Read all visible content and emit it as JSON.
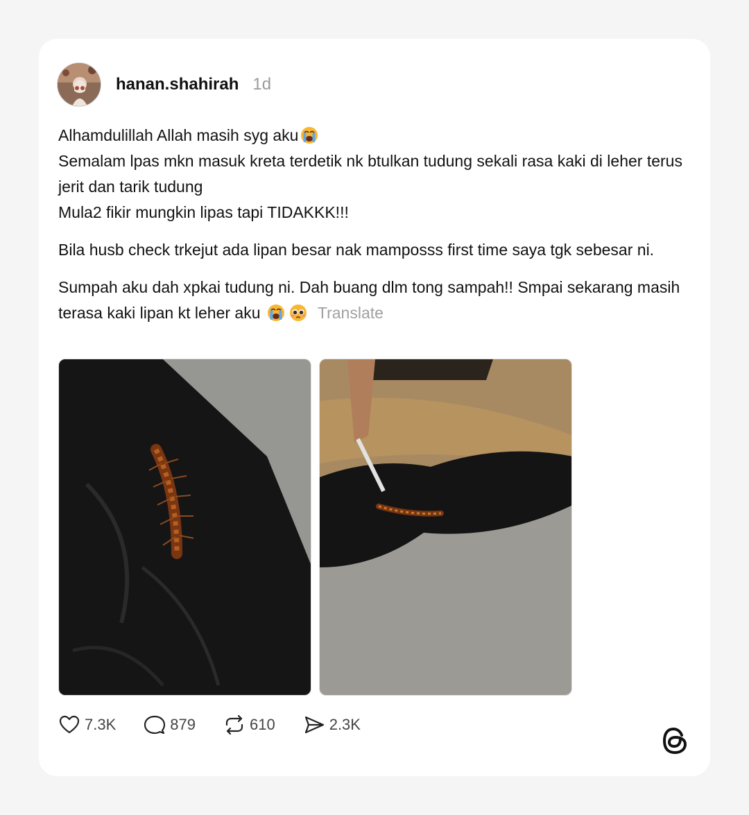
{
  "post": {
    "username": "hanan.shahirah",
    "time": "1d",
    "paragraphs": {
      "p1_line1": "Alhamdulillah Allah masih syg aku",
      "p1_line2": "Semalam lpas mkn masuk kreta terdetik nk btulkan tudung sekali rasa kaki di leher terus jerit dan tarik tudung",
      "p1_line3": "Mula2 fikir mungkin lipas tapi TIDAKKK!!!",
      "p2": "Bila husb check trkejut ada lipan besar nak mamposss first time saya tgk sebesar ni.",
      "p3": "Sumpah aku dah xpkai tudung ni. Dah buang dlm tong sampah!! Smpai sekarang masih terasa kaki lipan kt leher aku"
    },
    "translate_label": "Translate",
    "emojis": [
      "loudly-crying-face",
      "loudly-crying-face",
      "pleading-face"
    ],
    "media": [
      {
        "name": "centipede-on-black-cloth-closeup"
      },
      {
        "name": "centipede-on-black-cloth-on-road"
      }
    ]
  },
  "actions": {
    "likes": "7.3K",
    "replies": "879",
    "reposts": "610",
    "shares": "2.3K"
  },
  "icons": {
    "like": "heart-icon",
    "reply": "speech-bubble-icon",
    "repost": "repost-icon",
    "share": "send-icon",
    "brand": "threads-logo-icon"
  },
  "colors": {
    "background": "#f5f5f5",
    "card": "#ffffff",
    "muted": "#9a9a9a",
    "text": "#111111"
  }
}
